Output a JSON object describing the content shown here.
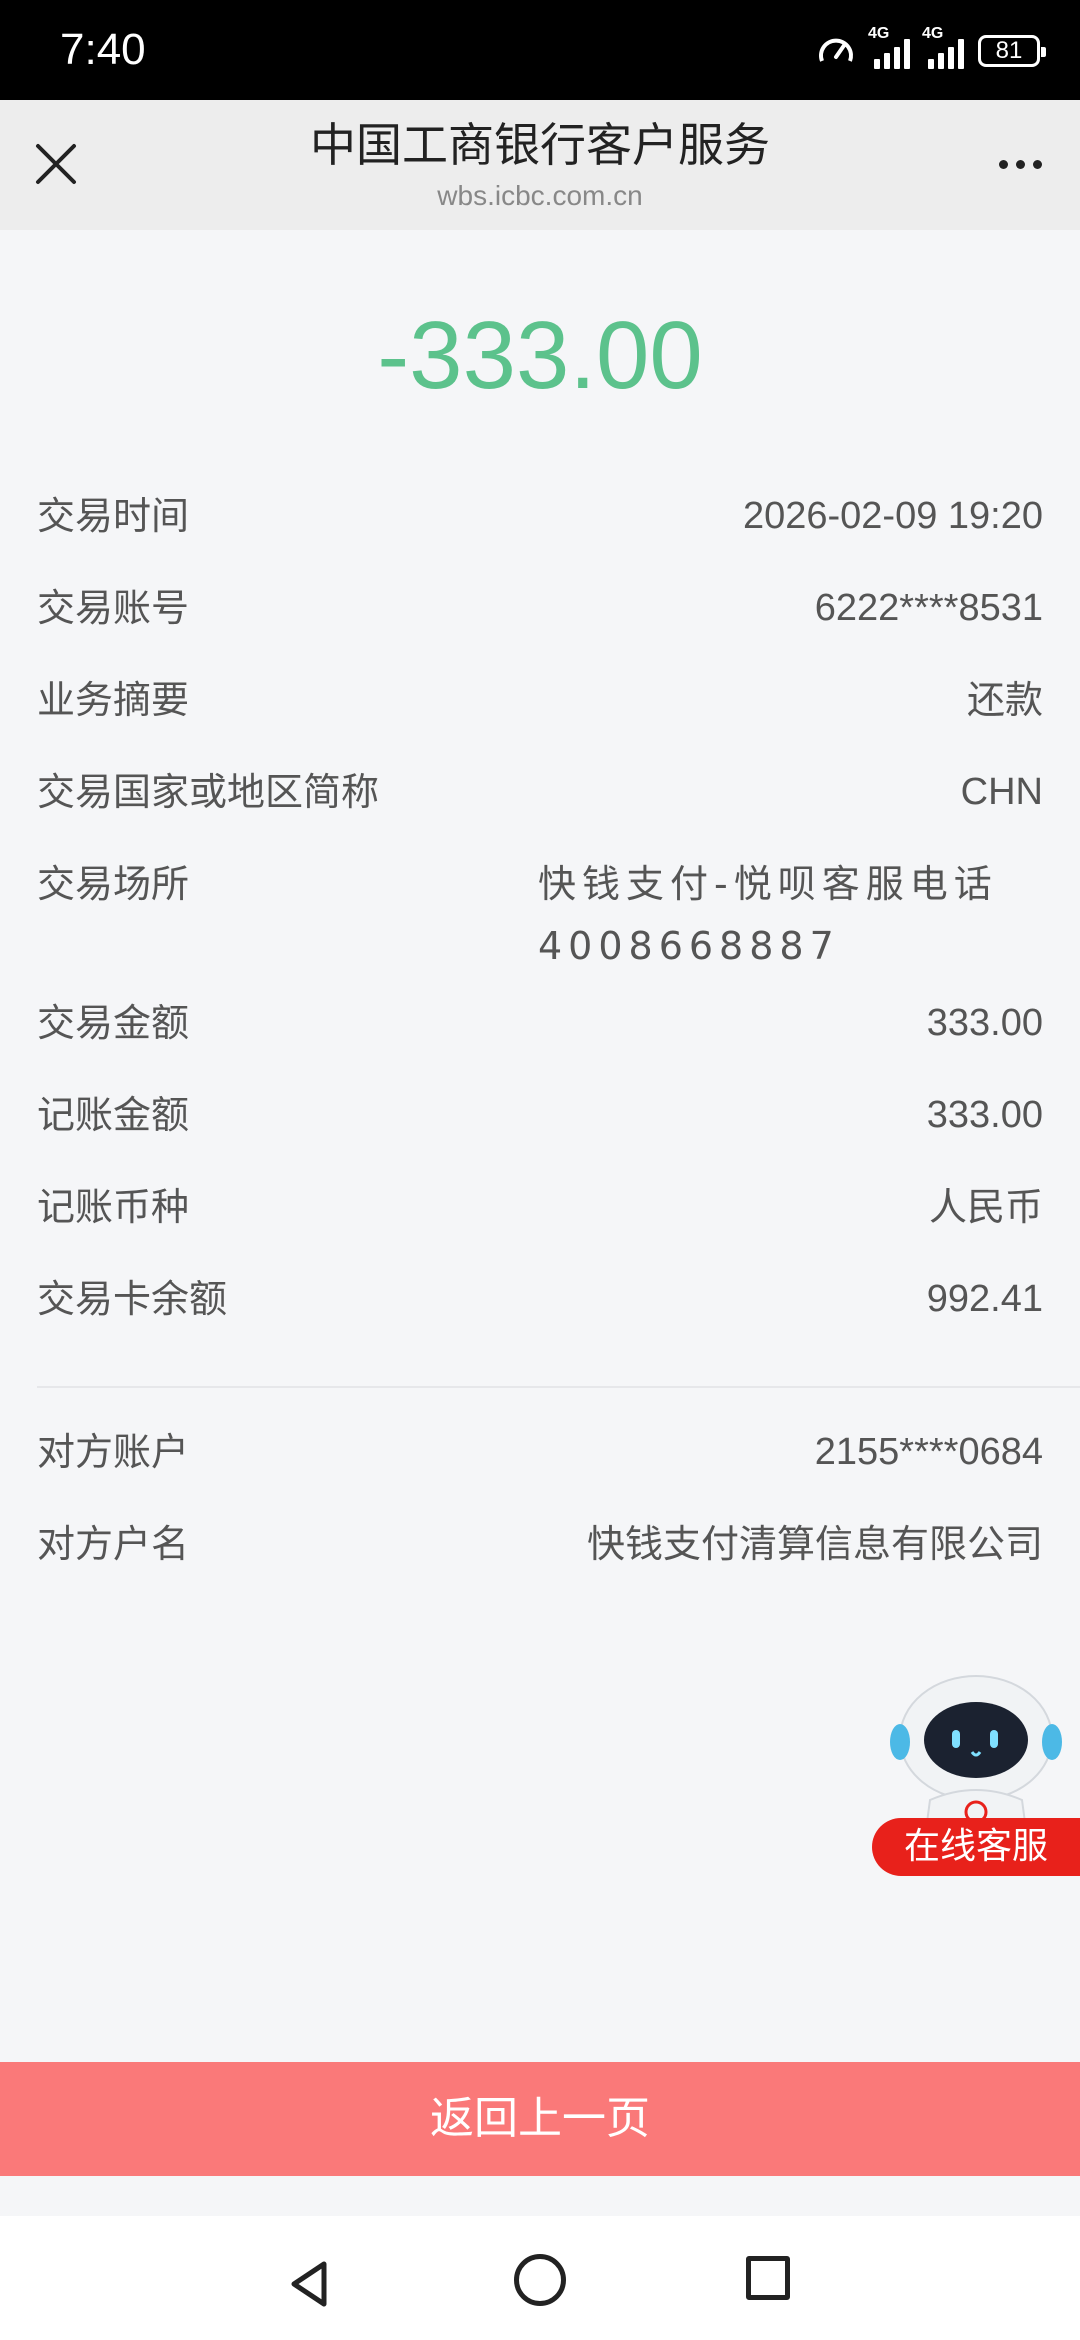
{
  "status_bar": {
    "time": "7:40",
    "network_1": "4G",
    "network_2": "4G",
    "battery": "81",
    "icons": [
      "speed-gauge-icon",
      "signal-icon",
      "signal-icon",
      "battery-icon"
    ]
  },
  "header": {
    "title": "中国工商银行客户服务",
    "url": "wbs.icbc.com.cn",
    "close_icon": "close-icon",
    "more_icon": "more-icon"
  },
  "amount": "-333.00",
  "amount_color": "#5cc28c",
  "details": [
    {
      "label": "交易时间",
      "value": "2026-02-09 19:20"
    },
    {
      "label": "交易账号",
      "value": "6222****8531"
    },
    {
      "label": "业务摘要",
      "value": "还款"
    },
    {
      "label": "交易国家或地区简称",
      "value": "CHN"
    },
    {
      "label": "交易场所",
      "value": "快钱支付-悦呗客服电话4008668887"
    },
    {
      "label": "交易金额",
      "value": "333.00"
    },
    {
      "label": "记账金额",
      "value": "333.00"
    },
    {
      "label": "记账币种",
      "value": "人民币"
    },
    {
      "label": "交易卡余额",
      "value": "992.41"
    }
  ],
  "counterparty": [
    {
      "label": "对方账户",
      "value": "2155****0684"
    },
    {
      "label": "对方户名",
      "value": "快钱支付清算信息有限公司"
    }
  ],
  "online_service": "在线客服",
  "back_button": "返回上一页",
  "accent_colors": {
    "button": "#fa7979",
    "service": "#e8211b"
  },
  "nav_bar": [
    "back-icon",
    "home-icon",
    "recent-apps-icon"
  ]
}
